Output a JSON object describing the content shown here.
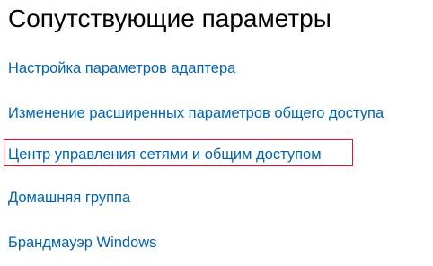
{
  "section": {
    "title": "Сопутствующие параметры"
  },
  "links": [
    {
      "label": "Настройка параметров адаптера"
    },
    {
      "label": "Изменение расширенных параметров общего доступа"
    },
    {
      "label": "Центр управления сетями и общим доступом",
      "highlighted": true
    },
    {
      "label": "Домашняя группа"
    },
    {
      "label": "Брандмауэр Windows"
    }
  ],
  "colors": {
    "link": "#0063b1",
    "heading": "#000000",
    "highlight_border": "#e81123",
    "background": "#ffffff"
  }
}
